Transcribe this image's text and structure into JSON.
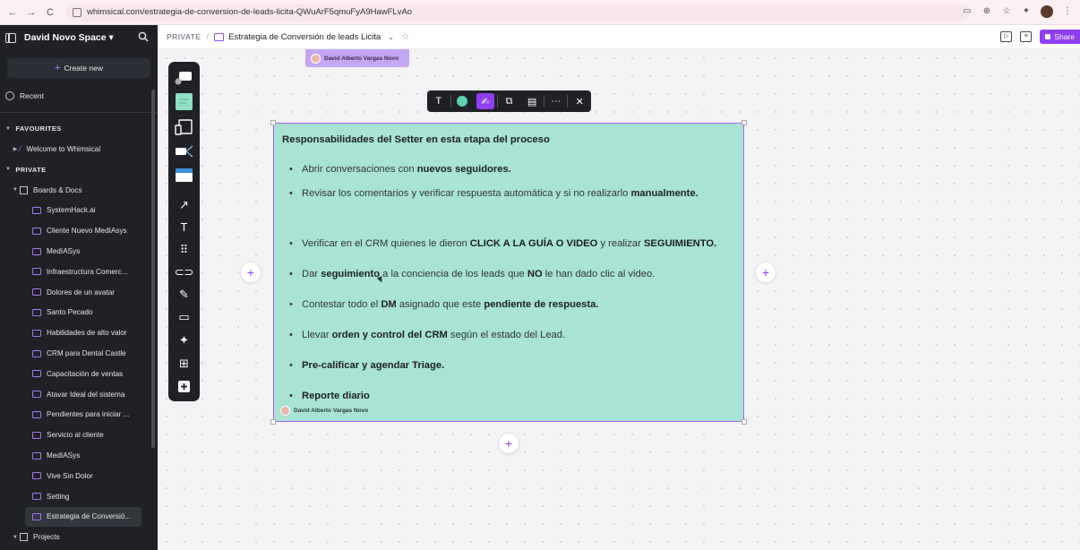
{
  "browser": {
    "url": "whimsical.com/estrategia-de-conversion-de-leads-licita-QWuArF5qmuFyA9HawFLvAo",
    "nav_back": "←",
    "nav_forward": "→",
    "nav_reload": "C"
  },
  "sidebar": {
    "space_name": "David Novo Space ▾",
    "create_label": "Create new",
    "recent_label": "Recent",
    "favourites_label": "FAVOURITES",
    "favourites_items": [
      {
        "label": "Welcome to Whimsical"
      }
    ],
    "private_label": "PRIVATE",
    "folder_label": "Boards & Docs",
    "items": [
      {
        "label": "SystemHack.ai"
      },
      {
        "label": "Cliente Nuevo MedIAsys"
      },
      {
        "label": "MedIASys"
      },
      {
        "label": "Infraestructura Comerc..."
      },
      {
        "label": "Dolores de un avatar"
      },
      {
        "label": "Santo Pecado"
      },
      {
        "label": "Habilidades de alto valor"
      },
      {
        "label": "CRM para Dental Castle"
      },
      {
        "label": "Capacitación de ventas"
      },
      {
        "label": "Atavar Ideal del sistema"
      },
      {
        "label": "Pendientes para iniciar ..."
      },
      {
        "label": "Servicio al cliente"
      },
      {
        "label": "MedIASys"
      },
      {
        "label": "Vive Sin Dolor"
      },
      {
        "label": "Setting"
      },
      {
        "label": "Estrategia de Conversió..."
      }
    ],
    "projects_label": "Projects"
  },
  "topbar": {
    "private_label": "PRIVATE",
    "separator": "/",
    "board_title": "Estrategia de Conversión de leads Licita",
    "share_label": "Share"
  },
  "canvas": {
    "author_tag": "David Alberto Vargas Novo",
    "note": {
      "title": "Responsabilidades del Setter en esta etapa del proceso",
      "author": "David Alberto Vargas Novo",
      "bullets": [
        {
          "parts": [
            "Abrir conversaciones con ",
            "nuevos seguidores."
          ]
        },
        {
          "parts": [
            "Revisar los comentarios y verificar respuesta automática y si no realizarlo ",
            "manualmente."
          ]
        },
        {
          "parts": [
            " Verificar en el CRM quienes le dieron ",
            "CLICK A LA GUÍA O VIDEO",
            " y realizar ",
            "SEGUIMIENTO."
          ]
        },
        {
          "parts": [
            "Dar ",
            "seguimiento",
            " a la conciencia de los leads que ",
            "NO",
            " le han dado clic al video."
          ]
        },
        {
          "parts": [
            "Contestar todo el ",
            "DM",
            " asignado que este ",
            "pendiente de respuesta."
          ]
        },
        {
          "parts": [
            "Llevar ",
            "orden y control del CRM",
            " según el estado del Lead."
          ]
        },
        {
          "parts": [
            "",
            "Pre-calificar y agendar Triage."
          ]
        },
        {
          "parts": [
            "",
            "Reporte diario"
          ]
        }
      ]
    },
    "plus_symbol": "+"
  },
  "icons": {
    "search": "search-icon",
    "star": "star-icon",
    "present": "present-icon",
    "comments": "comment-icon",
    "lock": "lock-icon"
  },
  "colors": {
    "accent": "#8f3ef0",
    "note_bg": "#a8e3d6",
    "sidebar_bg": "#1f2126"
  }
}
